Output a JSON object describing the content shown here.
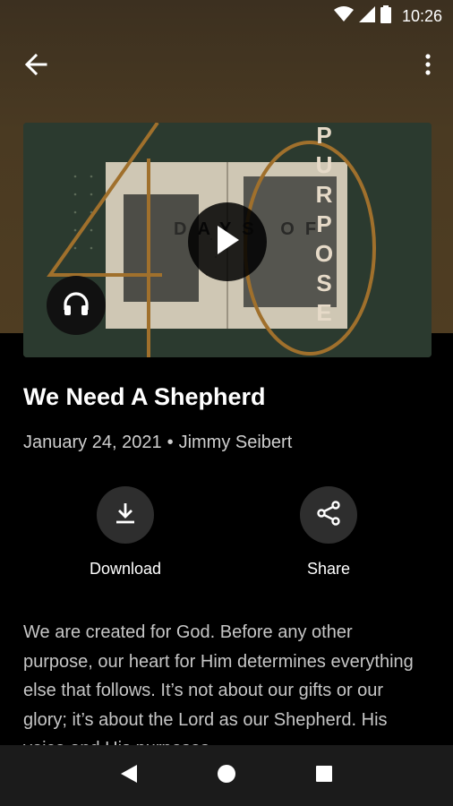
{
  "status_bar": {
    "time": "10:26",
    "icons": [
      "wifi-icon",
      "signal-icon",
      "battery-icon"
    ]
  },
  "app_bar": {
    "back_icon": "arrow-left-icon",
    "more_icon": "more-vertical-icon"
  },
  "artwork": {
    "number": "40",
    "overlay_text": "DAYS OF",
    "vertical_text": "PURPOSE",
    "accent_color": "#a0702c",
    "background_color": "#2b3a2f"
  },
  "episode": {
    "title": "We Need A Shepherd",
    "date": "January 24, 2021",
    "separator": "•",
    "speaker": "Jimmy Seibert"
  },
  "actions": {
    "download_label": "Download",
    "share_label": "Share"
  },
  "description": "We are created for God. Before any other purpose, our heart for Him determines everything else that follows. It’s not about our gifts or our glory; it’s about the Lord as our Shepherd. His voice and His purposes.",
  "nav": {
    "back_icon": "nav-back-icon",
    "home_icon": "nav-home-icon",
    "recents_icon": "nav-recents-icon"
  }
}
